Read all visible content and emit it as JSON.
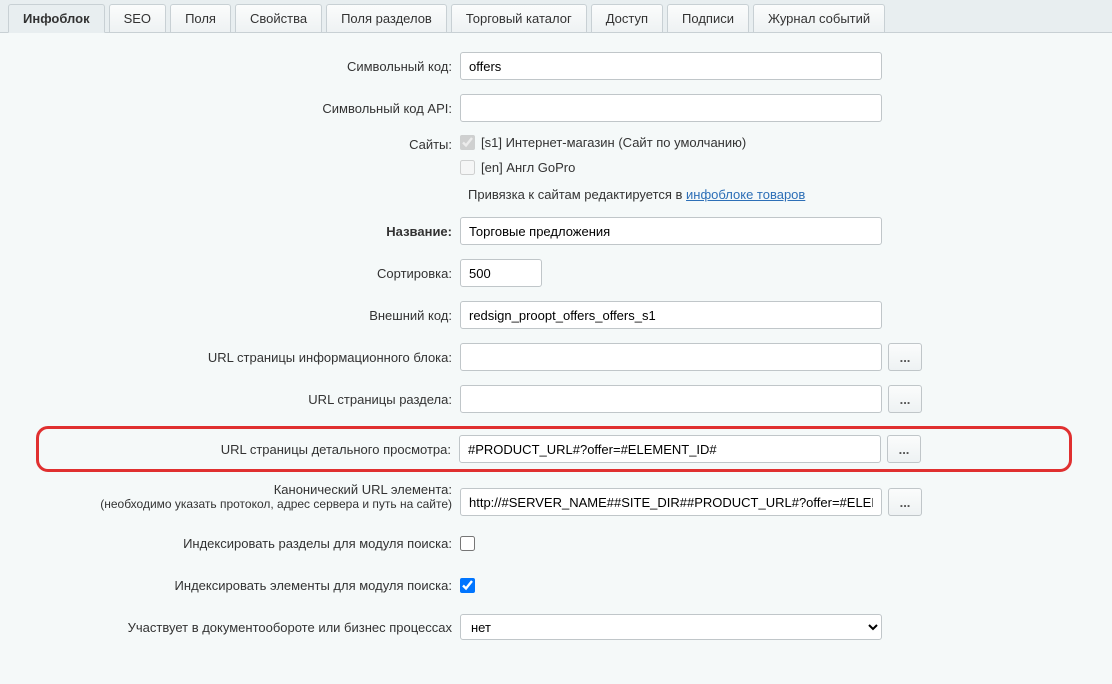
{
  "tabs": {
    "t0": "Инфоблок",
    "t1": "SEO",
    "t2": "Поля",
    "t3": "Свойства",
    "t4": "Поля разделов",
    "t5": "Торговый каталог",
    "t6": "Доступ",
    "t7": "Подписи",
    "t8": "Журнал событий"
  },
  "labels": {
    "symcode": "Символьный код:",
    "symcode_api": "Символьный код API:",
    "sites": "Сайты:",
    "site1": "[s1] Интернет-магазин (Сайт по умолчанию)",
    "site2": "[en] Англ GoPro",
    "binding_prefix": "Привязка к сайтам редактируется в ",
    "binding_link": "инфоблоке товаров",
    "name": "Название:",
    "sort": "Сортировка:",
    "extcode": "Внешний код:",
    "url_block": "URL страницы информационного блока:",
    "url_section": "URL страницы раздела:",
    "url_detail": "URL страницы детального просмотра:",
    "canonical": "Канонический URL элемента:",
    "canonical_sub": "(необходимо указать протокол, адрес сервера и путь на сайте)",
    "index_sections": "Индексировать разделы для модуля поиска:",
    "index_elements": "Индексировать элементы для модуля поиска:",
    "workflow": "Участвует в документообороте или бизнес процессах",
    "ellipsis": "..."
  },
  "values": {
    "symcode": "offers",
    "symcode_api": "",
    "name": "Торговые предложения",
    "sort": "500",
    "extcode": "redsign_proopt_offers_offers_s1",
    "url_block": "",
    "url_section": "",
    "url_detail": "#PRODUCT_URL#?offer=#ELEMENT_ID#",
    "canonical": "http://#SERVER_NAME##SITE_DIR##PRODUCT_URL#?offer=#ELEM",
    "workflow_option": "нет"
  }
}
